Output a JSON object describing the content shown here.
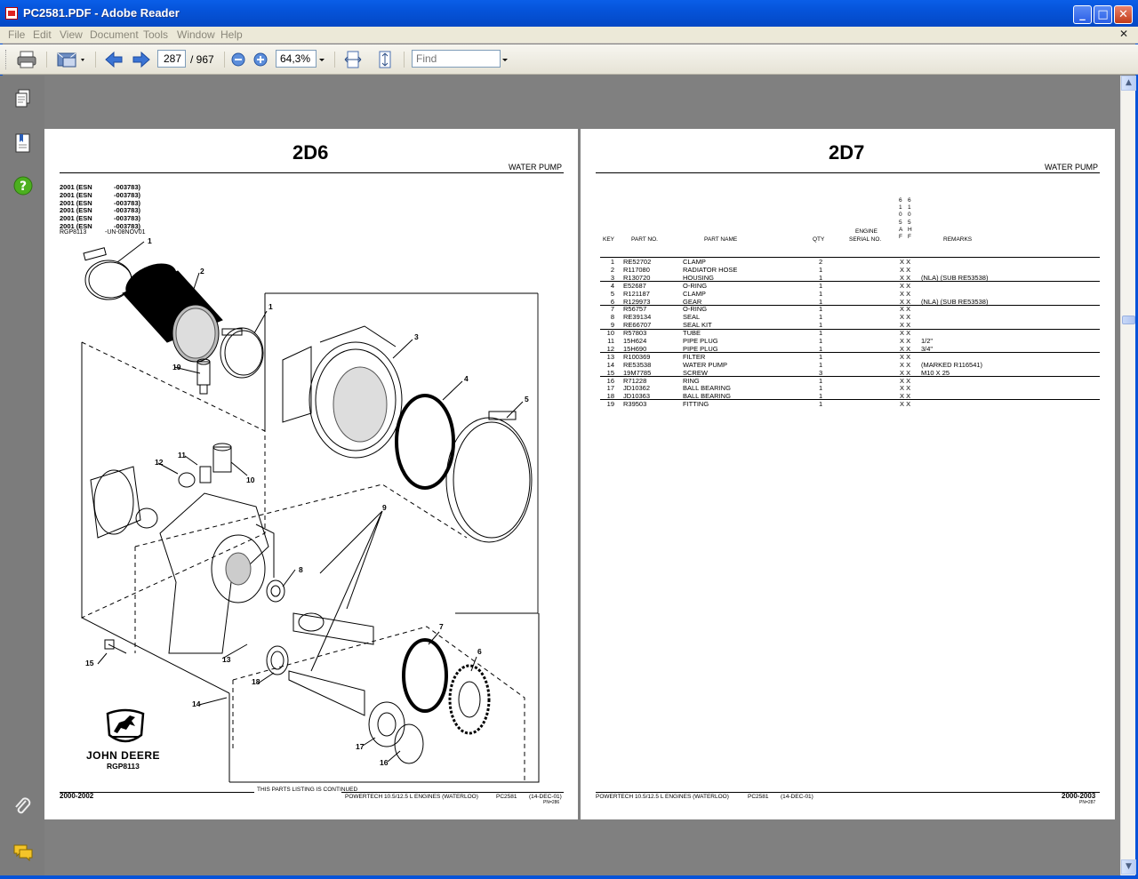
{
  "window": {
    "title": "PC2581.PDF - Adobe Reader",
    "controls": {
      "minimize": "_",
      "maximize": "□",
      "close": "✕"
    }
  },
  "menu": {
    "items": [
      "File",
      "Edit",
      "View",
      "Document",
      "Tools",
      "Window",
      "Help"
    ],
    "close_glyph": "✕"
  },
  "toolbar": {
    "page_current": "287",
    "page_total": "/ 967",
    "zoom_value": "64,3%",
    "find_placeholder": "Find"
  },
  "colors": {
    "titlebar": "#0553d9",
    "workspace": "#808080",
    "menubar": "#ece9d8",
    "nav_help": "#4caf1f",
    "nav_comment": "#f3c429"
  },
  "icons": [
    "print-icon",
    "email-icon",
    "previous-page-icon",
    "next-page-icon",
    "zoom-out-icon",
    "zoom-in-icon",
    "fit-width-icon",
    "fit-page-icon",
    "pages-icon",
    "bookmarks-icon",
    "help-icon",
    "attachments-icon",
    "comments-icon"
  ],
  "page_left": {
    "page_code": "2D6",
    "section": "WATER PUMP",
    "esn_lines": [
      {
        "year": "2001 (ESN",
        "range": "-003783)"
      },
      {
        "year": "2001 (ESN",
        "range": "-003783)"
      },
      {
        "year": "2001 (ESN",
        "range": "-003783)"
      },
      {
        "year": "2001 (ESN",
        "range": "-003783)"
      },
      {
        "year": "2001 (ESN",
        "range": "-003783)"
      },
      {
        "year": "2001 (ESN",
        "range": "-003783)"
      }
    ],
    "illus_ref": "RGP8113",
    "illus_date": "-UN-08NOV01",
    "callouts": [
      "1",
      "2",
      "1",
      "3",
      "19",
      "4",
      "5",
      "11",
      "12",
      "10",
      "9",
      "8",
      "7",
      "6",
      "13",
      "15",
      "18",
      "14",
      "17",
      "16"
    ],
    "logo_text": "JOHN DEERE",
    "logo_code": "RGP8113",
    "footer_range": "2000-2002",
    "footer_continued": "THIS PARTS LISTING IS CONTINUED",
    "footer_engine": "POWERTECH 10.5/12.5 L ENGINES (WATERLOO)",
    "footer_code": "PC2581",
    "footer_date": "(14-DEC-01)",
    "footer_pn": "PN=286"
  },
  "page_right": {
    "page_code": "2D7",
    "section": "WATER PUMP",
    "columns": {
      "key": "KEY",
      "part_no": "PART NO.",
      "part_name": "PART NAME",
      "qty": "QTY",
      "engine": "ENGINE",
      "serial": "SERIAL NO.",
      "remarks": "REMARKS",
      "code1": [
        "6",
        "1",
        "0",
        "5",
        "A",
        "F"
      ],
      "code2": [
        "6",
        "1",
        "0",
        "5",
        "H",
        "F"
      ]
    },
    "rows": [
      {
        "key": "1",
        "part": "RE52702",
        "name": "CLAMP",
        "qty": "2",
        "x": "X  X",
        "remarks": ""
      },
      {
        "key": "2",
        "part": "R117080",
        "name": "RADIATOR HOSE",
        "qty": "1",
        "x": "X  X",
        "remarks": ""
      },
      {
        "key": "3",
        "part": "R130720",
        "name": "HOUSING",
        "qty": "1",
        "x": "X  X",
        "remarks": "(NLA) (SUB RE53538)"
      },
      {
        "key": "4",
        "part": "E52687",
        "name": "O-RING",
        "qty": "1",
        "x": "X  X",
        "remarks": ""
      },
      {
        "key": "5",
        "part": "R121187",
        "name": "CLAMP",
        "qty": "1",
        "x": "X  X",
        "remarks": ""
      },
      {
        "key": "6",
        "part": "R129973",
        "name": "GEAR",
        "qty": "1",
        "x": "X  X",
        "remarks": "(NLA) (SUB RE53538)"
      },
      {
        "key": "7",
        "part": "R56757",
        "name": "O-RING",
        "qty": "1",
        "x": "X  X",
        "remarks": ""
      },
      {
        "key": "8",
        "part": "RE39134",
        "name": "SEAL",
        "qty": "1",
        "x": "X  X",
        "remarks": ""
      },
      {
        "key": "9",
        "part": "RE66707",
        "name": "SEAL KIT",
        "qty": "1",
        "x": "X  X",
        "remarks": ""
      },
      {
        "key": "10",
        "part": "R57803",
        "name": "TUBE",
        "qty": "1",
        "x": "X  X",
        "remarks": ""
      },
      {
        "key": "11",
        "part": "15H624",
        "name": "PIPE PLUG",
        "qty": "1",
        "x": "X  X",
        "remarks": "1/2\""
      },
      {
        "key": "12",
        "part": "15H690",
        "name": "PIPE PLUG",
        "qty": "1",
        "x": "X  X",
        "remarks": "3/4\""
      },
      {
        "key": "13",
        "part": "R100369",
        "name": "FILTER",
        "qty": "1",
        "x": "X  X",
        "remarks": ""
      },
      {
        "key": "14",
        "part": "RE53538",
        "name": "WATER PUMP",
        "qty": "1",
        "x": "X  X",
        "remarks": "(MARKED R116541)"
      },
      {
        "key": "15",
        "part": "19M7785",
        "name": "SCREW",
        "qty": "3",
        "x": "X  X",
        "remarks": "M10 X 25"
      },
      {
        "key": "16",
        "part": "R71228",
        "name": "RING",
        "qty": "1",
        "x": "X  X",
        "remarks": ""
      },
      {
        "key": "17",
        "part": "JD10362",
        "name": "BALL BEARING",
        "qty": "1",
        "x": "X  X",
        "remarks": ""
      },
      {
        "key": "18",
        "part": "JD10363",
        "name": "BALL BEARING",
        "qty": "1",
        "x": "X  X",
        "remarks": ""
      },
      {
        "key": "19",
        "part": "R39503",
        "name": "FITTING",
        "qty": "1",
        "x": "X  X",
        "remarks": ""
      }
    ],
    "footer_engine": "POWERTECH 10.5/12.5 L ENGINES (WATERLOO)",
    "footer_code": "PC2581",
    "footer_date": "(14-DEC-01)",
    "footer_range": "2000-2003",
    "footer_pn": "PN=287"
  }
}
